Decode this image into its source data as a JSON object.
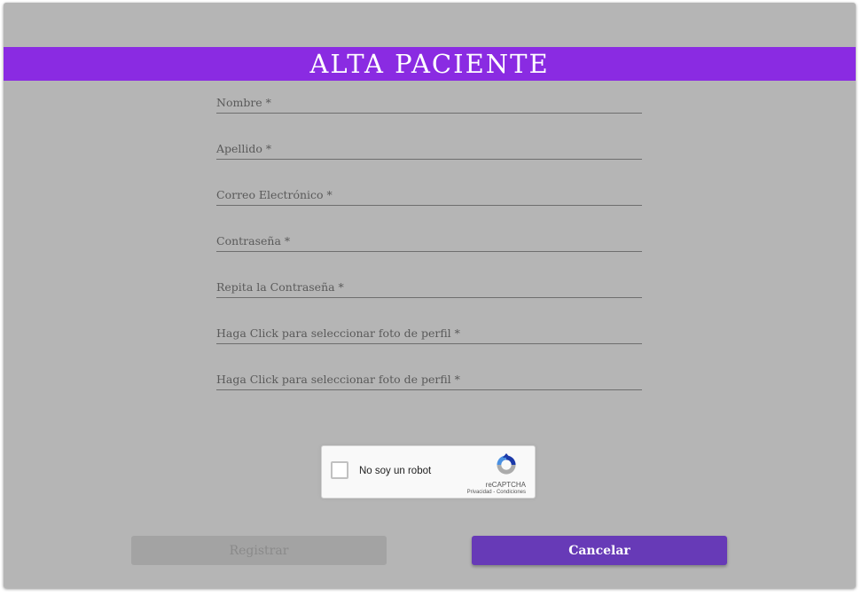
{
  "title": "ALTA PACIENTE",
  "fields": [
    {
      "label": "Nombre *"
    },
    {
      "label": "Apellido *"
    },
    {
      "label": "Correo Electrónico *"
    },
    {
      "label": "Contraseña *"
    },
    {
      "label": "Repita la Contraseña *"
    },
    {
      "label": "Haga Click para seleccionar foto de perfil *"
    },
    {
      "label": "Haga Click para seleccionar foto de perfil *"
    }
  ],
  "captcha": {
    "label": "No soy un robot",
    "brand": "reCAPTCHA",
    "links": "Privacidad - Condiciones"
  },
  "buttons": {
    "register": "Registrar",
    "cancel": "Cancelar"
  },
  "colors": {
    "title_bar": "#8a2be2",
    "card_bg": "#b5b5b5",
    "cancel_button": "#673ab7",
    "register_button_disabled": "#a3a3a3"
  }
}
